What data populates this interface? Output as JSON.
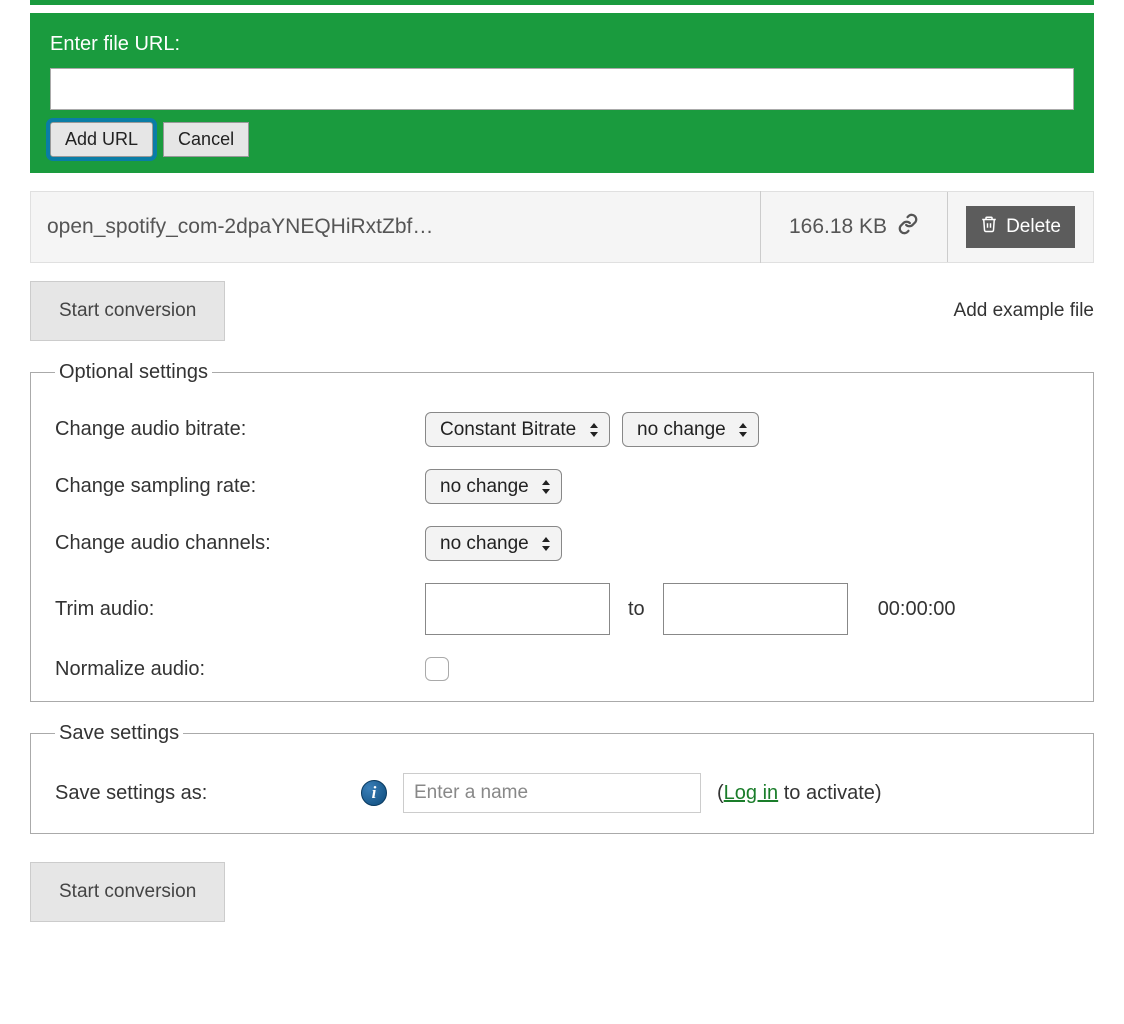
{
  "urlSection": {
    "label": "Enter file URL:",
    "value": "",
    "addBtn": "Add URL",
    "cancelBtn": "Cancel"
  },
  "file": {
    "name": "open_spotify_com-2dpaYNEQHiRxtZbf…",
    "size": "166.18 KB",
    "deleteLabel": "Delete"
  },
  "startBtn": "Start conversion",
  "exampleLink": "Add example file",
  "optional": {
    "legend": "Optional settings",
    "bitrate": {
      "label": "Change audio bitrate:",
      "mode": "Constant Bitrate",
      "value": "no change"
    },
    "sampling": {
      "label": "Change sampling rate:",
      "value": "no change"
    },
    "channels": {
      "label": "Change audio channels:",
      "value": "no change"
    },
    "trim": {
      "label": "Trim audio:",
      "from": "",
      "sep": "to",
      "to": "",
      "duration": "00:00:00"
    },
    "normalize": {
      "label": "Normalize audio:"
    }
  },
  "save": {
    "legend": "Save settings",
    "label": "Save settings as:",
    "placeholder": "Enter a name",
    "noteOpen": "(",
    "loginText": "Log in",
    "noteRest": " to activate)"
  }
}
